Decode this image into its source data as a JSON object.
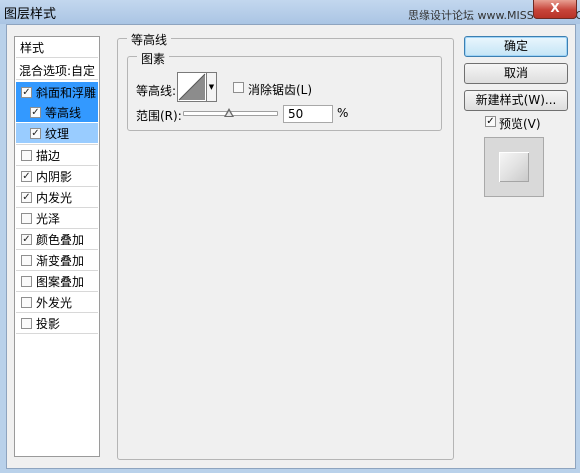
{
  "window": {
    "title": "图层样式",
    "watermark": "思缘设计论坛 www.MISSYUAN.COM",
    "close_glyph": "X"
  },
  "style_list": {
    "header": "样式",
    "blend_options": "混合选项:自定",
    "items": [
      {
        "label": "斜面和浮雕",
        "checked": true,
        "state": "selected"
      },
      {
        "label": "等高线",
        "checked": true,
        "state": "selected-sub"
      },
      {
        "label": "纹理",
        "checked": true,
        "state": "highlighted-sub"
      },
      {
        "label": "描边",
        "checked": false
      },
      {
        "label": "内阴影",
        "checked": true
      },
      {
        "label": "内发光",
        "checked": true
      },
      {
        "label": "光泽",
        "checked": false
      },
      {
        "label": "颜色叠加",
        "checked": true
      },
      {
        "label": "渐变叠加",
        "checked": false
      },
      {
        "label": "图案叠加",
        "checked": false
      },
      {
        "label": "外发光",
        "checked": false
      },
      {
        "label": "投影",
        "checked": false
      }
    ]
  },
  "panel": {
    "title": "等高线",
    "group_title": "图素",
    "contour_label": "等高线:",
    "antialias_label": "消除锯齿(L)",
    "antialias_checked": false,
    "range_label": "范围(R):",
    "range_value": "50",
    "range_unit": "%"
  },
  "buttons": {
    "ok": "确定",
    "cancel": "取消",
    "new_style": "新建样式(W)...",
    "preview_label": "预览(V)",
    "preview_checked": true
  },
  "colors": {
    "selection": "#3399ff",
    "sub_selection": "#99ccff",
    "close": "#c7443a"
  }
}
